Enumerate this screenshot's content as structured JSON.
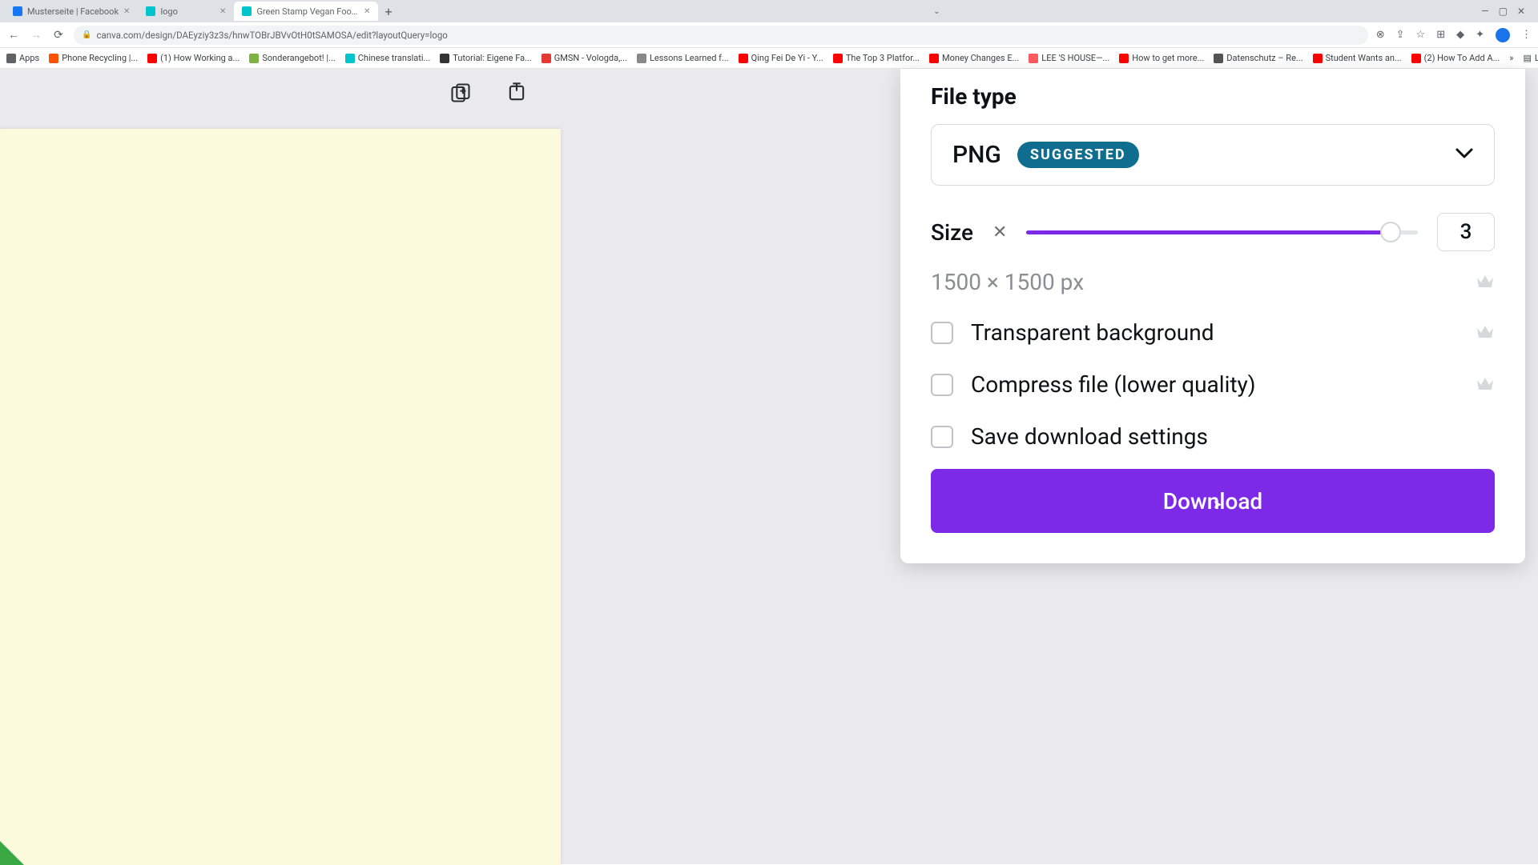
{
  "browser": {
    "tabs": [
      {
        "title": "Musterseite | Facebook",
        "favicon_bg": "#1877f2"
      },
      {
        "title": "logo",
        "favicon_bg": "#00c4cc"
      },
      {
        "title": "Green Stamp Vegan Food Res",
        "favicon_bg": "#00c4cc"
      }
    ],
    "url": "canva.com/design/DAEyziy3z3s/hnwTOBrJBVvOtH0tSAMOSA/edit?layoutQuery=logo",
    "bookmarks": [
      {
        "label": "Apps",
        "fav": "#5f6368"
      },
      {
        "label": "Phone Recycling |...",
        "fav": "#ff5100"
      },
      {
        "label": "(1) How Working a...",
        "fav": "#ff0000"
      },
      {
        "label": "Sonderangebot! |...",
        "fav": "#7cb342"
      },
      {
        "label": "Chinese translati...",
        "fav": "#00c4cc"
      },
      {
        "label": "Tutorial: Eigene Fa...",
        "fav": "#333"
      },
      {
        "label": "GMSN - Vologda,...",
        "fav": "#e53935"
      },
      {
        "label": "Lessons Learned f...",
        "fav": "#888"
      },
      {
        "label": "Qing Fei De Yi - Y...",
        "fav": "#ff0000"
      },
      {
        "label": "The Top 3 Platfor...",
        "fav": "#ff0000"
      },
      {
        "label": "Money Changes E...",
        "fav": "#ff0000"
      },
      {
        "label": "LEE 'S HOUSE—...",
        "fav": "#ff5a5f"
      },
      {
        "label": "How to get more...",
        "fav": "#ff0000"
      },
      {
        "label": "Datenschutz – Re...",
        "fav": "#555"
      },
      {
        "label": "Student Wants an...",
        "fav": "#ff0000"
      },
      {
        "label": "(2) How To Add A...",
        "fav": "#ff0000"
      }
    ],
    "bookmark_right": "Leseliste"
  },
  "panel": {
    "heading": "File type",
    "filetype": "PNG",
    "suggested_badge": "SUGGESTED",
    "size_label": "Size",
    "size_value": "3",
    "dimensions": "1500 × 1500 px",
    "opt_transparent": "Transparent background",
    "opt_compress": "Compress file (lower quality)",
    "opt_save_settings": "Save download settings",
    "download_btn": "Download"
  }
}
